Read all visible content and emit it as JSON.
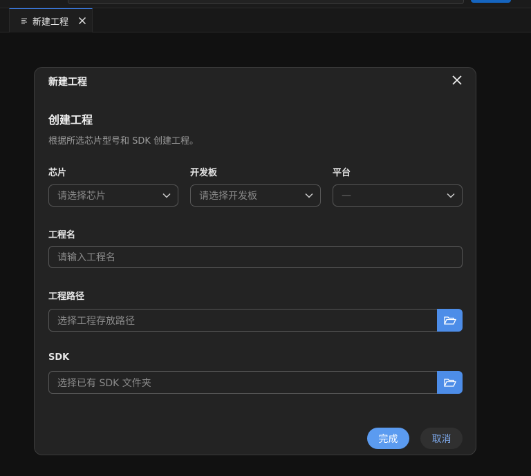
{
  "tab": {
    "label": "新建工程",
    "icon": "document-lines-icon"
  },
  "dialog": {
    "title": "新建工程",
    "section_title": "创建工程",
    "description": "根据所选芯片型号和 SDK 创建工程。",
    "chip": {
      "label": "芯片",
      "placeholder": "请选择芯片"
    },
    "board": {
      "label": "开发板",
      "placeholder": "请选择开发板"
    },
    "platform": {
      "label": "平台",
      "value": "—"
    },
    "project_name": {
      "label": "工程名",
      "placeholder": "请输入工程名"
    },
    "project_path": {
      "label": "工程路径",
      "placeholder": "选择工程存放路径"
    },
    "sdk": {
      "label": "SDK",
      "placeholder": "选择已有 SDK 文件夹"
    },
    "confirm_label": "完成",
    "cancel_label": "取消"
  },
  "colors": {
    "accent": "#5b9bf0",
    "folder_button": "#4d8de8",
    "background": "#111111",
    "dialog": "#232323"
  }
}
